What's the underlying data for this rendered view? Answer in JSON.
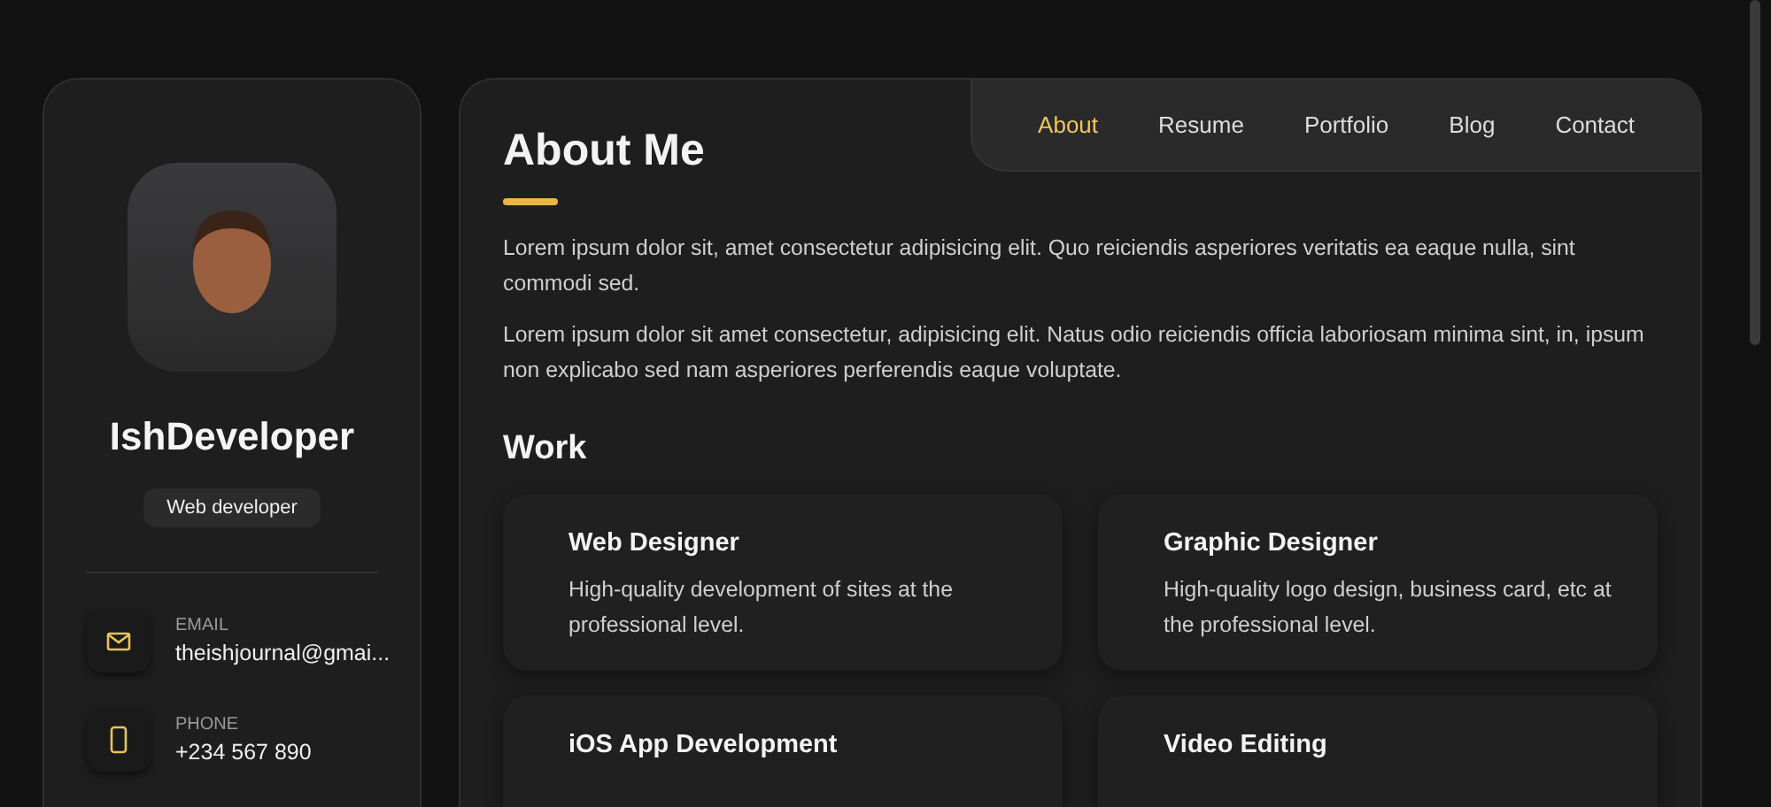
{
  "sidebar": {
    "name": "IshDeveloper",
    "title": "Web developer",
    "contacts": [
      {
        "kind": "email",
        "label": "EMAIL",
        "value": "theishjournal@gmai..."
      },
      {
        "kind": "phone",
        "label": "PHONE",
        "value": "+234 567 890"
      }
    ]
  },
  "nav": [
    {
      "label": "About",
      "selected": true
    },
    {
      "label": "Resume",
      "selected": false
    },
    {
      "label": "Portfolio",
      "selected": false
    },
    {
      "label": "Blog",
      "selected": false
    },
    {
      "label": "Contact",
      "selected": false
    }
  ],
  "about": {
    "title": "About Me",
    "paragraphs": [
      "Lorem ipsum dolor sit, amet consectetur adipisicing elit. Quo reiciendis asperiores veritatis ea eaque nulla, sint commodi sed.",
      "Lorem ipsum dolor sit amet consectetur, adipisicing elit. Natus odio reiciendis officia laboriosam minima sint, in, ipsum non explicabo sed nam asperiores perferendis eaque voluptate."
    ]
  },
  "work": {
    "title": "Work",
    "services": [
      {
        "title": "Web Designer",
        "text": "High-quality development of sites at the professional level."
      },
      {
        "title": "Graphic Designer",
        "text": "High-quality logo design, business card, etc at the professional level."
      },
      {
        "title": "iOS App Development"
      },
      {
        "title": "Video Editing"
      }
    ]
  }
}
